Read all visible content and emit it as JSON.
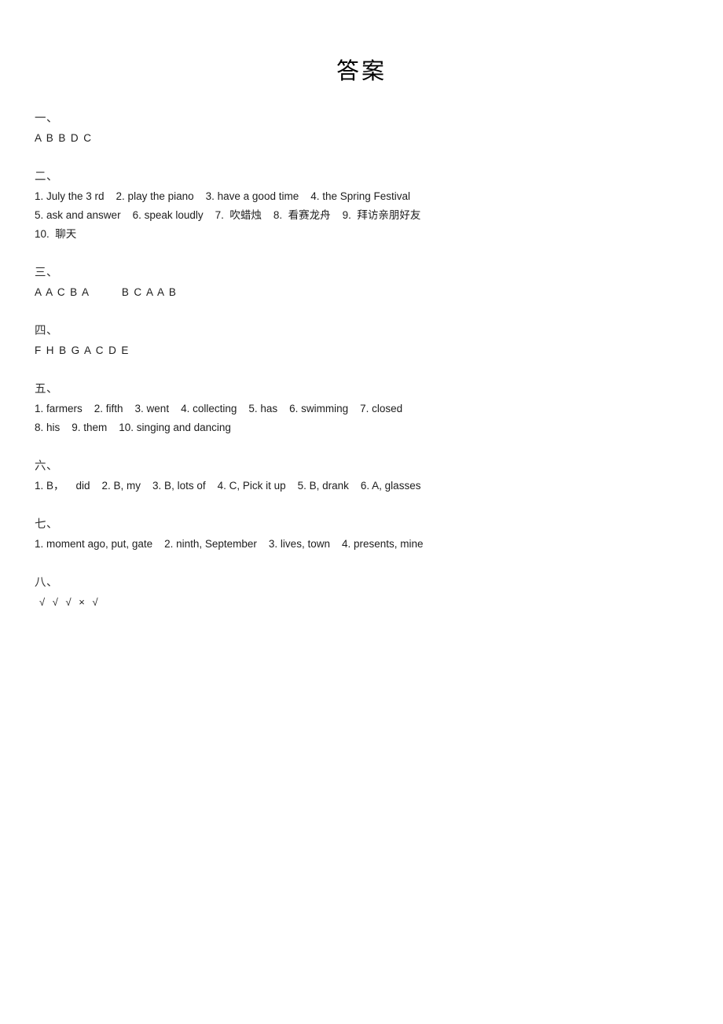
{
  "document": {
    "title": "答案",
    "page_background": "#ffffff",
    "text_color": "#1d1d1d"
  },
  "sections": [
    {
      "heading": "一、",
      "lines": [
        "A B B D C"
      ],
      "style": "letters"
    },
    {
      "heading": "二、",
      "lines": [
        "1. July the 3 rd    2. play the piano    3. have a good time    4. the Spring Festival",
        "5. ask and answer    6. speak loudly    7.  吹蜡烛    8.  看赛龙舟    9.  拜访亲朋好友",
        "10.  聊天"
      ],
      "style": "text"
    },
    {
      "heading": "三、",
      "lines": [
        "A A C B A        B C A A B"
      ],
      "style": "letters"
    },
    {
      "heading": "四、",
      "lines": [
        "F H B G A C D E"
      ],
      "style": "letters"
    },
    {
      "heading": "五、",
      "lines": [
        "1. farmers    2. fifth    3. went    4. collecting    5. has    6. swimming    7. closed",
        "8. his    9. them    10. singing and dancing"
      ],
      "style": "text"
    },
    {
      "heading": "六、",
      "lines": [
        "1. B，    did    2. B, my    3. B, lots of    4. C, Pick it up    5. B, drank    6. A, glasses"
      ],
      "style": "text"
    },
    {
      "heading": "七、",
      "lines": [
        "1. moment ago, put, gate    2. ninth, September    3. lives, town    4. presents, mine"
      ],
      "style": "text"
    },
    {
      "heading": "八、",
      "lines": [
        "√ √ √ × √"
      ],
      "style": "marks"
    }
  ]
}
